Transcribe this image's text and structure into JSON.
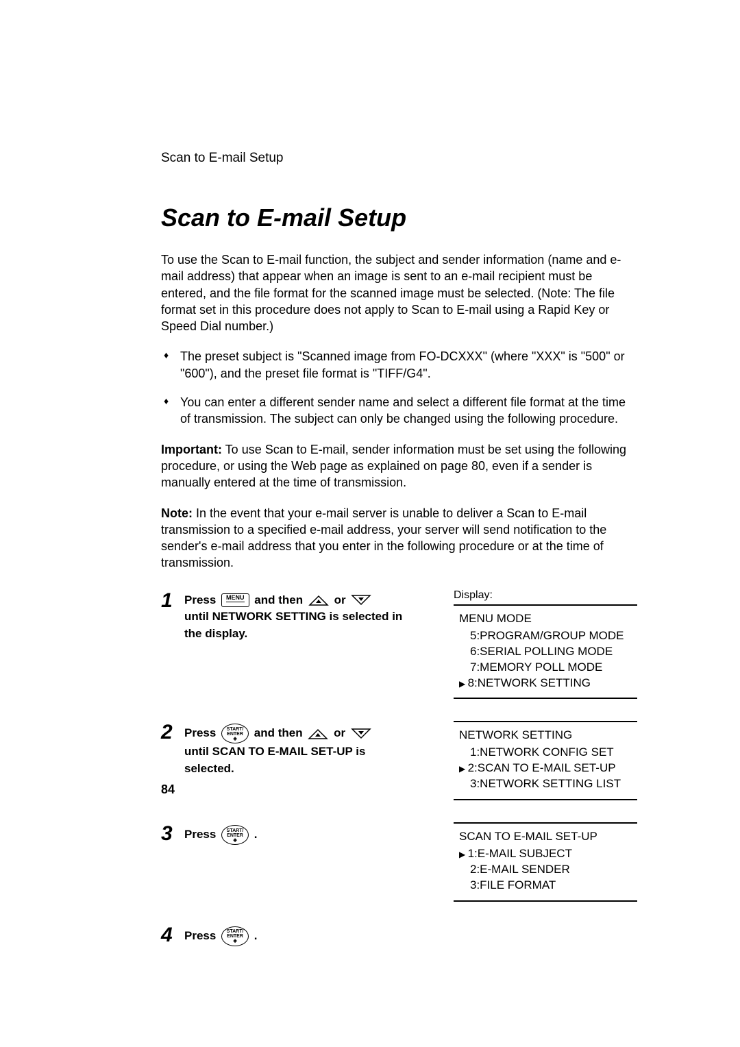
{
  "running_head": "Scan to E-mail Setup",
  "title": "Scan to E-mail Setup",
  "intro": "To use the Scan to E-mail function, the subject and sender information (name and e-mail address) that appear when an image is sent to an e-mail recipient must be entered, and the file format for the scanned image must be selected. (Note: The file format set in this procedure does not apply to Scan to E-mail using a Rapid Key or Speed Dial number.)",
  "bullets": [
    "The preset subject is \"Scanned image from FO-DCXXX\" (where \"XXX\" is \"500\" or \"600\"), and the preset file format is \"TIFF/G4\".",
    "You can enter a different sender name and select a different file format at the time of transmission. The subject can only be changed using the following procedure."
  ],
  "important_label": "Important:",
  "important_text": " To use Scan to E-mail, sender information must be set using the following procedure, or using the Web page as explained on page 80, even if a sender is manually entered at the time of transmission.",
  "note_label": "Note:",
  "note_text": " In the event that your e-mail server is unable to deliver a Scan to E-mail transmission to a specified e-mail address, your server will send notification to the sender's e-mail address that you enter in the following procedure or at the time of transmission.",
  "display_label": "Display:",
  "key_menu_label": "MENU",
  "key_enter_top": "START/",
  "key_enter_mid": "ENTER",
  "steps": {
    "s1": {
      "press": "Press ",
      "mid": " and then ",
      "or": " or ",
      "rest1": "until NETWORK SETTING is selected in",
      "rest2": "the display."
    },
    "s2": {
      "press": "Press ",
      "mid": " and then ",
      "or": " or ",
      "rest1": "until SCAN TO E-MAIL SET-UP is",
      "rest2": "selected."
    },
    "s3": {
      "press": "Press ",
      "dot": "."
    },
    "s4": {
      "press": "Press ",
      "dot": "."
    }
  },
  "displays": {
    "d1": {
      "header": "MENU MODE",
      "items": [
        "5:PROGRAM/GROUP MODE",
        "6:SERIAL POLLING MODE",
        "7:MEMORY POLL MODE"
      ],
      "selected": "8:NETWORK SETTING"
    },
    "d2": {
      "header": "NETWORK SETTING",
      "items_before": [
        "1:NETWORK CONFIG SET"
      ],
      "selected": "2:SCAN TO E-MAIL SET-UP",
      "items_after": [
        "3:NETWORK SETTING LIST"
      ]
    },
    "d3": {
      "header": "SCAN TO E-MAIL SET-UP",
      "selected": "1:E-MAIL SUBJECT",
      "items_after": [
        "2:E-MAIL SENDER",
        "3:FILE FORMAT"
      ]
    }
  },
  "page_number": "84"
}
